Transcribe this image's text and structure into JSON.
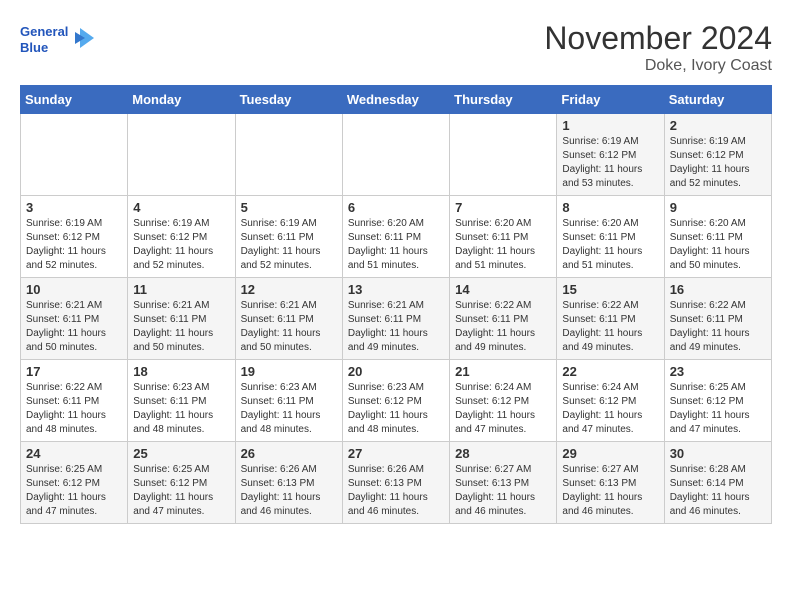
{
  "header": {
    "logo_line1": "General",
    "logo_line2": "Blue",
    "title": "November 2024",
    "subtitle": "Doke, Ivory Coast"
  },
  "days_of_week": [
    "Sunday",
    "Monday",
    "Tuesday",
    "Wednesday",
    "Thursday",
    "Friday",
    "Saturday"
  ],
  "weeks": [
    [
      {
        "day": "",
        "sunrise": "",
        "sunset": "",
        "daylight": ""
      },
      {
        "day": "",
        "sunrise": "",
        "sunset": "",
        "daylight": ""
      },
      {
        "day": "",
        "sunrise": "",
        "sunset": "",
        "daylight": ""
      },
      {
        "day": "",
        "sunrise": "",
        "sunset": "",
        "daylight": ""
      },
      {
        "day": "",
        "sunrise": "",
        "sunset": "",
        "daylight": ""
      },
      {
        "day": "1",
        "sunrise": "Sunrise: 6:19 AM",
        "sunset": "Sunset: 6:12 PM",
        "daylight": "Daylight: 11 hours and 53 minutes."
      },
      {
        "day": "2",
        "sunrise": "Sunrise: 6:19 AM",
        "sunset": "Sunset: 6:12 PM",
        "daylight": "Daylight: 11 hours and 52 minutes."
      }
    ],
    [
      {
        "day": "3",
        "sunrise": "Sunrise: 6:19 AM",
        "sunset": "Sunset: 6:12 PM",
        "daylight": "Daylight: 11 hours and 52 minutes."
      },
      {
        "day": "4",
        "sunrise": "Sunrise: 6:19 AM",
        "sunset": "Sunset: 6:12 PM",
        "daylight": "Daylight: 11 hours and 52 minutes."
      },
      {
        "day": "5",
        "sunrise": "Sunrise: 6:19 AM",
        "sunset": "Sunset: 6:11 PM",
        "daylight": "Daylight: 11 hours and 52 minutes."
      },
      {
        "day": "6",
        "sunrise": "Sunrise: 6:20 AM",
        "sunset": "Sunset: 6:11 PM",
        "daylight": "Daylight: 11 hours and 51 minutes."
      },
      {
        "day": "7",
        "sunrise": "Sunrise: 6:20 AM",
        "sunset": "Sunset: 6:11 PM",
        "daylight": "Daylight: 11 hours and 51 minutes."
      },
      {
        "day": "8",
        "sunrise": "Sunrise: 6:20 AM",
        "sunset": "Sunset: 6:11 PM",
        "daylight": "Daylight: 11 hours and 51 minutes."
      },
      {
        "day": "9",
        "sunrise": "Sunrise: 6:20 AM",
        "sunset": "Sunset: 6:11 PM",
        "daylight": "Daylight: 11 hours and 50 minutes."
      }
    ],
    [
      {
        "day": "10",
        "sunrise": "Sunrise: 6:21 AM",
        "sunset": "Sunset: 6:11 PM",
        "daylight": "Daylight: 11 hours and 50 minutes."
      },
      {
        "day": "11",
        "sunrise": "Sunrise: 6:21 AM",
        "sunset": "Sunset: 6:11 PM",
        "daylight": "Daylight: 11 hours and 50 minutes."
      },
      {
        "day": "12",
        "sunrise": "Sunrise: 6:21 AM",
        "sunset": "Sunset: 6:11 PM",
        "daylight": "Daylight: 11 hours and 50 minutes."
      },
      {
        "day": "13",
        "sunrise": "Sunrise: 6:21 AM",
        "sunset": "Sunset: 6:11 PM",
        "daylight": "Daylight: 11 hours and 49 minutes."
      },
      {
        "day": "14",
        "sunrise": "Sunrise: 6:22 AM",
        "sunset": "Sunset: 6:11 PM",
        "daylight": "Daylight: 11 hours and 49 minutes."
      },
      {
        "day": "15",
        "sunrise": "Sunrise: 6:22 AM",
        "sunset": "Sunset: 6:11 PM",
        "daylight": "Daylight: 11 hours and 49 minutes."
      },
      {
        "day": "16",
        "sunrise": "Sunrise: 6:22 AM",
        "sunset": "Sunset: 6:11 PM",
        "daylight": "Daylight: 11 hours and 49 minutes."
      }
    ],
    [
      {
        "day": "17",
        "sunrise": "Sunrise: 6:22 AM",
        "sunset": "Sunset: 6:11 PM",
        "daylight": "Daylight: 11 hours and 48 minutes."
      },
      {
        "day": "18",
        "sunrise": "Sunrise: 6:23 AM",
        "sunset": "Sunset: 6:11 PM",
        "daylight": "Daylight: 11 hours and 48 minutes."
      },
      {
        "day": "19",
        "sunrise": "Sunrise: 6:23 AM",
        "sunset": "Sunset: 6:11 PM",
        "daylight": "Daylight: 11 hours and 48 minutes."
      },
      {
        "day": "20",
        "sunrise": "Sunrise: 6:23 AM",
        "sunset": "Sunset: 6:12 PM",
        "daylight": "Daylight: 11 hours and 48 minutes."
      },
      {
        "day": "21",
        "sunrise": "Sunrise: 6:24 AM",
        "sunset": "Sunset: 6:12 PM",
        "daylight": "Daylight: 11 hours and 47 minutes."
      },
      {
        "day": "22",
        "sunrise": "Sunrise: 6:24 AM",
        "sunset": "Sunset: 6:12 PM",
        "daylight": "Daylight: 11 hours and 47 minutes."
      },
      {
        "day": "23",
        "sunrise": "Sunrise: 6:25 AM",
        "sunset": "Sunset: 6:12 PM",
        "daylight": "Daylight: 11 hours and 47 minutes."
      }
    ],
    [
      {
        "day": "24",
        "sunrise": "Sunrise: 6:25 AM",
        "sunset": "Sunset: 6:12 PM",
        "daylight": "Daylight: 11 hours and 47 minutes."
      },
      {
        "day": "25",
        "sunrise": "Sunrise: 6:25 AM",
        "sunset": "Sunset: 6:12 PM",
        "daylight": "Daylight: 11 hours and 47 minutes."
      },
      {
        "day": "26",
        "sunrise": "Sunrise: 6:26 AM",
        "sunset": "Sunset: 6:13 PM",
        "daylight": "Daylight: 11 hours and 46 minutes."
      },
      {
        "day": "27",
        "sunrise": "Sunrise: 6:26 AM",
        "sunset": "Sunset: 6:13 PM",
        "daylight": "Daylight: 11 hours and 46 minutes."
      },
      {
        "day": "28",
        "sunrise": "Sunrise: 6:27 AM",
        "sunset": "Sunset: 6:13 PM",
        "daylight": "Daylight: 11 hours and 46 minutes."
      },
      {
        "day": "29",
        "sunrise": "Sunrise: 6:27 AM",
        "sunset": "Sunset: 6:13 PM",
        "daylight": "Daylight: 11 hours and 46 minutes."
      },
      {
        "day": "30",
        "sunrise": "Sunrise: 6:28 AM",
        "sunset": "Sunset: 6:14 PM",
        "daylight": "Daylight: 11 hours and 46 minutes."
      }
    ]
  ]
}
